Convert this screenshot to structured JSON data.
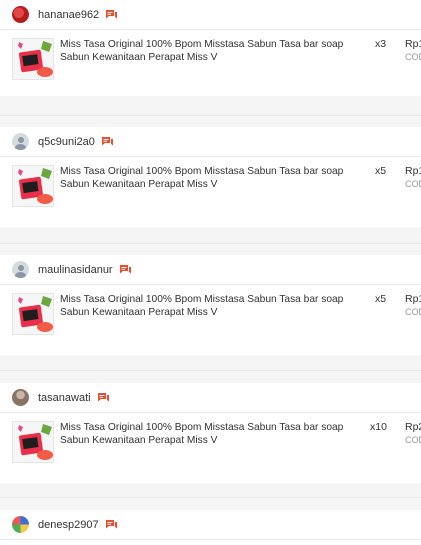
{
  "orders": [
    {
      "username": "hananae962",
      "avatar": "red",
      "product": "Miss Tasa Original 100% Bpom Misstasa Sabun Tasa bar soap Sabun Kewanitaan Perapat Miss V",
      "qty": "x3",
      "price": "Rp1",
      "payment": "COD"
    },
    {
      "username": "q5c9uni2a0",
      "avatar": "default",
      "product": "Miss Tasa Original 100% Bpom Misstasa Sabun Tasa bar soap Sabun Kewanitaan Perapat Miss V",
      "qty": "x5",
      "price": "Rp1",
      "payment": "COD"
    },
    {
      "username": "maulinasidanur",
      "avatar": "default",
      "product": "Miss Tasa Original 100% Bpom Misstasa Sabun Tasa bar soap Sabun Kewanitaan Perapat Miss V",
      "qty": "x5",
      "price": "Rp1",
      "payment": "COD"
    },
    {
      "username": "tasanawati",
      "avatar": "photo",
      "product": "Miss Tasa Original 100% Bpom Misstasa Sabun Tasa bar soap Sabun Kewanitaan Perapat Miss V",
      "qty": "x10",
      "price": "Rp2",
      "payment": "COD"
    },
    {
      "username": "denesp2907",
      "avatar": "multi",
      "product": "",
      "qty": "",
      "price": "",
      "payment": ""
    }
  ],
  "colors": {
    "chat_icon": "#ee4d2d",
    "product_box": "#e8304a",
    "brand_pink": "#e04e8a"
  }
}
